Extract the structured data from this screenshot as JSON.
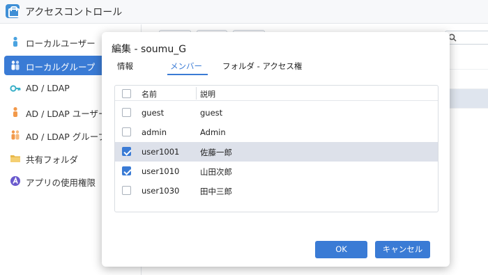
{
  "app": {
    "title": "アクセスコントロール"
  },
  "sidebar": {
    "items": [
      {
        "label": "ローカルユーザー",
        "icon": "user-icon",
        "color": "#4aa3e0"
      },
      {
        "label": "ローカルグループ",
        "icon": "group-icon",
        "color": "#ffffff"
      },
      {
        "label": "AD / LDAP",
        "icon": "key-icon",
        "color": "#3ab0c8"
      },
      {
        "label": "AD / LDAP ユーザー",
        "icon": "user-icon",
        "color": "#f2994a"
      },
      {
        "label": "AD / LDAP グループ",
        "icon": "group-icon",
        "color": "#f2994a"
      },
      {
        "label": "共有フォルダ",
        "icon": "folder-icon",
        "color": "#e8b84a"
      },
      {
        "label": "アプリの使用権限",
        "icon": "app-permission-icon",
        "color": "#6a5acd"
      }
    ]
  },
  "dialog": {
    "title": "編集 - soumu_G",
    "tabs": [
      "情報",
      "メンバー",
      "フォルダ - アクセス権"
    ],
    "active_tab": "メンバー",
    "columns": {
      "name": "名前",
      "description": "説明"
    },
    "rows": [
      {
        "name": "guest",
        "description": "guest",
        "checked": false
      },
      {
        "name": "admin",
        "description": "Admin",
        "checked": false
      },
      {
        "name": "user1001",
        "description": "佐藤一郎",
        "checked": true
      },
      {
        "name": "user1010",
        "description": "山田次郎",
        "checked": true
      },
      {
        "name": "user1030",
        "description": "田中三郎",
        "checked": false
      }
    ],
    "ok_label": "OK",
    "cancel_label": "キャンセル"
  },
  "colors": {
    "accent": "#3a7bd5",
    "selected_row": "#dde1ea"
  }
}
